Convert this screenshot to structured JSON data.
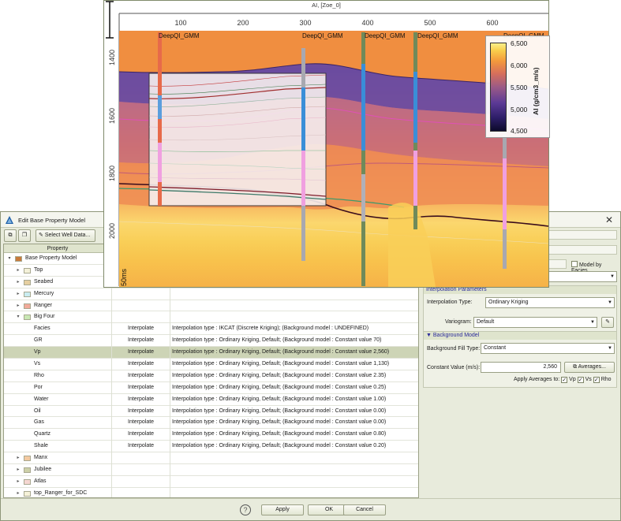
{
  "dialog": {
    "title": "Edit Base Property Model",
    "toolbar": {
      "select_well_data_label": "Select Well Data..."
    },
    "grid": {
      "columns": [
        "Property",
        "",
        ""
      ],
      "rows": [
        {
          "label": "Base Property Model",
          "depth": 0,
          "expander": "▾",
          "color": "#c87a3a",
          "method": "",
          "detail": ""
        },
        {
          "label": "Top",
          "depth": 1,
          "expander": "▸",
          "color": "#f4f1d9",
          "method": "",
          "detail": ""
        },
        {
          "label": "Seabed",
          "depth": 1,
          "expander": "▸",
          "color": "#e6cfa0",
          "method": "",
          "detail": ""
        },
        {
          "label": "Mercury",
          "depth": 1,
          "expander": "▸",
          "color": "#c9ecf1",
          "method": "",
          "detail": ""
        },
        {
          "label": "Ranger",
          "depth": 1,
          "expander": "▸",
          "color": "#f2aa9a",
          "method": "",
          "detail": ""
        },
        {
          "label": "Big Four",
          "depth": 1,
          "expander": "▾",
          "color": "#c9e8b4",
          "method": "",
          "detail": ""
        },
        {
          "label": "Facies",
          "depth": 2,
          "expander": "",
          "color": "",
          "method": "Interpolate",
          "detail": "Interpolation type : IKCAT (Discrete Kriging); (Background model : UNDEFINED)"
        },
        {
          "label": "GR",
          "depth": 2,
          "expander": "",
          "color": "",
          "method": "Interpolate",
          "detail": "Interpolation type : Ordinary Kriging, Default; (Background model : Constant value 70)"
        },
        {
          "label": "Vp",
          "depth": 2,
          "expander": "",
          "color": "",
          "method": "Interpolate",
          "detail": "Interpolation type : Ordinary Kriging, Default; (Background model : Constant value 2,560)",
          "selected": true
        },
        {
          "label": "Vs",
          "depth": 2,
          "expander": "",
          "color": "",
          "method": "Interpolate",
          "detail": "Interpolation type : Ordinary Kriging, Default; (Background model : Constant value 1,130)"
        },
        {
          "label": "Rho",
          "depth": 2,
          "expander": "",
          "color": "",
          "method": "Interpolate",
          "detail": "Interpolation type : Ordinary Kriging, Default; (Background model : Constant value 2.35)"
        },
        {
          "label": "Por",
          "depth": 2,
          "expander": "",
          "color": "",
          "method": "Interpolate",
          "detail": "Interpolation type : Ordinary Kriging, Default; (Background model : Constant value 0.25)"
        },
        {
          "label": "Water",
          "depth": 2,
          "expander": "",
          "color": "",
          "method": "Interpolate",
          "detail": "Interpolation type : Ordinary Kriging, Default; (Background model : Constant value 1.00)"
        },
        {
          "label": "Oil",
          "depth": 2,
          "expander": "",
          "color": "",
          "method": "Interpolate",
          "detail": "Interpolation type : Ordinary Kriging, Default; (Background model : Constant value 0.00)"
        },
        {
          "label": "Gas",
          "depth": 2,
          "expander": "",
          "color": "",
          "method": "Interpolate",
          "detail": "Interpolation type : Ordinary Kriging, Default; (Background model : Constant value 0.00)"
        },
        {
          "label": "Quartz",
          "depth": 2,
          "expander": "",
          "color": "",
          "method": "Interpolate",
          "detail": "Interpolation type : Ordinary Kriging, Default; (Background model : Constant value 0.80)"
        },
        {
          "label": "Shale",
          "depth": 2,
          "expander": "",
          "color": "",
          "method": "Interpolate",
          "detail": "Interpolation type : Ordinary Kriging, Default; (Background model : Constant value 0.20)"
        },
        {
          "label": "Manx",
          "depth": 1,
          "expander": "▸",
          "color": "#f3c9a0",
          "method": "",
          "detail": ""
        },
        {
          "label": "Jubilee",
          "depth": 1,
          "expander": "▸",
          "color": "#cdd0a8",
          "method": "",
          "detail": ""
        },
        {
          "label": "Atlas",
          "depth": 1,
          "expander": "▸",
          "color": "#f6d7d2",
          "method": "",
          "detail": ""
        },
        {
          "label": "top_Ranger_for_SDC",
          "depth": 1,
          "expander": "▸",
          "color": "#f6f2d9",
          "method": "",
          "detail": ""
        }
      ]
    },
    "panel": {
      "model_by_facies_label": "Model by Facies",
      "interp_group_title": "Interpolation Parameters",
      "interpolation_type_label": "Interpolation Type:",
      "interpolation_type_value": "Ordinary Kriging",
      "variogram_label": "Variogram:",
      "variogram_value": "Default",
      "background_group_title": "Background Model",
      "background_fill_type_label": "Background Fill Type:",
      "background_fill_type_value": "Constant",
      "constant_value_label": "Constant Value (m/s):",
      "constant_value": "2,560",
      "averages_button_label": "Averages...",
      "apply_averages_label": "Apply Averages to:",
      "apply_vp_label": "Vp",
      "apply_vs_label": "Vs",
      "apply_rho_label": "Rho"
    },
    "footer": {
      "apply_label": "Apply",
      "ok_label": "OK",
      "cancel_label": "Cancel"
    }
  },
  "section": {
    "title": "AI, [Zoe_0]",
    "trace_ticks": [
      "100",
      "200",
      "300",
      "400",
      "500",
      "600"
    ],
    "time_ticks": [
      "1400",
      "1600",
      "1800",
      "2000"
    ],
    "wells": [
      "DeepQI_GMM",
      "DeepQI_GMM",
      "DeepQI_GMM",
      "DeepQI_GMM",
      "DeepQI_GMM"
    ],
    "colorbar": {
      "label": "AI (g/cm3_m/s)",
      "ticks": [
        "6,500",
        "6,000",
        "5,500",
        "5,000",
        "4,500"
      ]
    },
    "scale_label": "50ms"
  }
}
